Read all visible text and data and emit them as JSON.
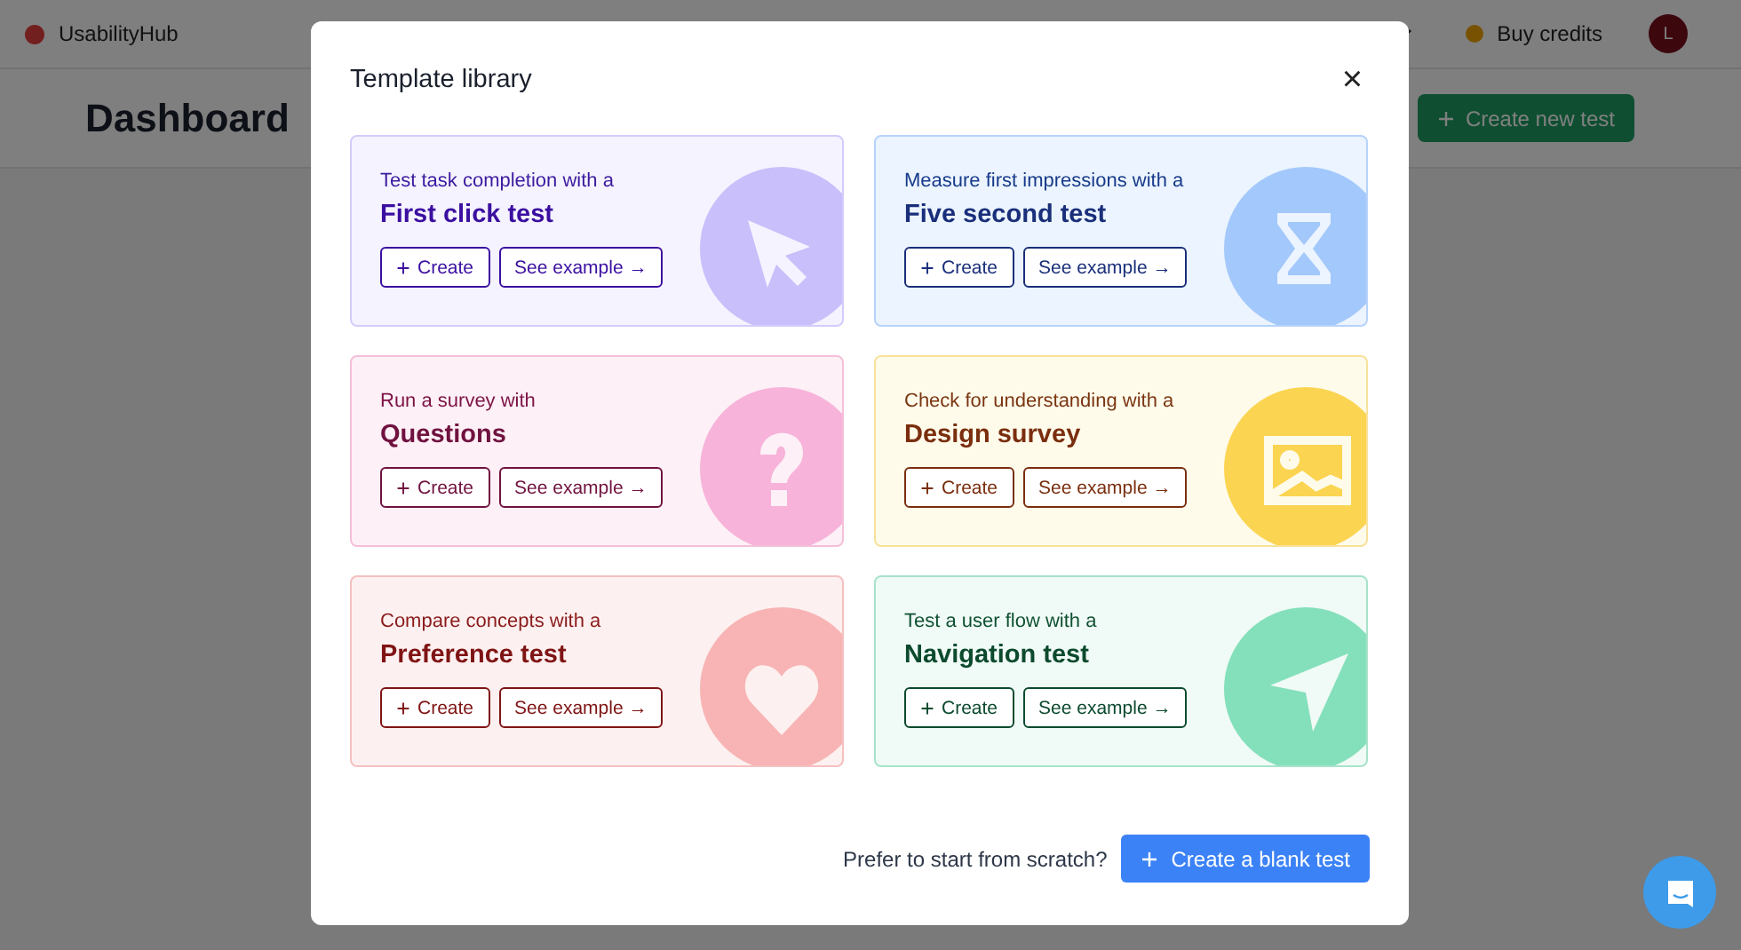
{
  "header": {
    "brand": "UsabilityHub",
    "credits": "Buy credits",
    "avatar": "L"
  },
  "page": {
    "title": "Dashboard",
    "action": "Create new test"
  },
  "modal": {
    "title": "Template library",
    "close": "×",
    "cards": [
      {
        "kind": "cursor",
        "color": "#c8bffb",
        "subtitle": "Test task completion with a",
        "title": "First click test",
        "create": "Create",
        "example": "See example →"
      },
      {
        "kind": "hourglass",
        "color": "#a3c8fb",
        "subtitle": "Measure first impressions with a",
        "title": "Five second test",
        "create": "Create",
        "example": "See example →"
      },
      {
        "kind": "question",
        "color": "#f7b3d9",
        "subtitle": "Run a survey with",
        "title": "Questions",
        "create": "Create",
        "example": "See example →"
      },
      {
        "kind": "image",
        "color": "#fbd451",
        "subtitle": "Check for understanding with a",
        "title": "Design survey",
        "create": "Create",
        "example": "See example →"
      },
      {
        "kind": "heart",
        "color": "#f8b4b4",
        "subtitle": "Compare concepts with a",
        "title": "Preference test",
        "create": "Create",
        "example": "See example →"
      },
      {
        "kind": "navigation",
        "color": "#84e0bb",
        "subtitle": "Test a user flow with a",
        "title": "Navigation test",
        "create": "Create",
        "example": "See example →"
      }
    ],
    "footer": {
      "prompt": "Prefer to start from scratch?",
      "button": "Create a blank test"
    }
  }
}
